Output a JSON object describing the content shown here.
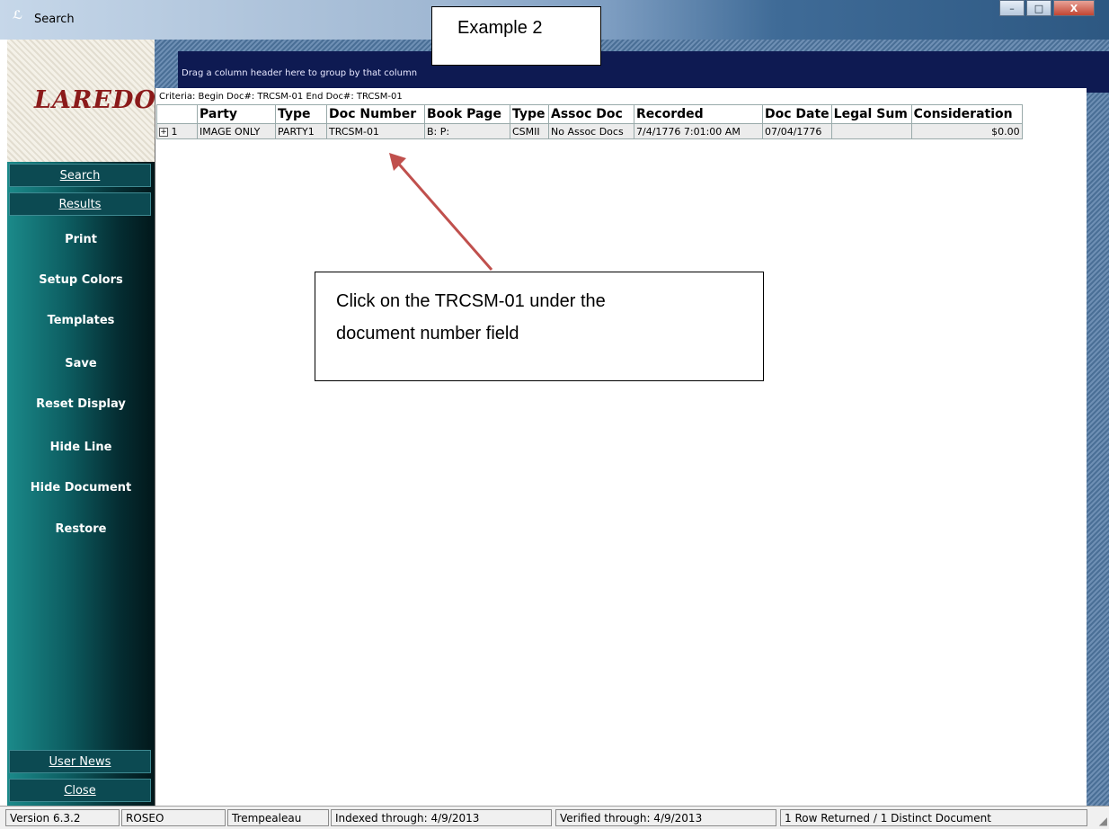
{
  "window": {
    "title": "Search",
    "app_icon": "laredo-app-icon",
    "controls": {
      "minimize": "–",
      "maximize": "□",
      "close": "X"
    }
  },
  "callouts": {
    "top": "Example 2",
    "main_line1": "Click on the TRCSM-01 under the",
    "main_line2": "document number field",
    "arrow_color": "#c0504d"
  },
  "sidebar": {
    "logo": "LAREDO",
    "tabs": {
      "search": "Search",
      "results": "Results"
    },
    "items": [
      "Print",
      "Setup Colors",
      "Templates",
      "Save",
      "Reset Display",
      "Hide Line",
      "Hide Document",
      "Restore"
    ],
    "bottom_tabs": {
      "user_news": "User News",
      "close": "Close"
    }
  },
  "main": {
    "group_hint": "Drag a column header here to group by that column",
    "criteria": "Criteria: Begin Doc#: TRCSM-01 End Doc#: TRCSM-01",
    "columns": [
      "",
      "Party",
      "Type",
      "Doc Number",
      "Book Page",
      "Type",
      "Assoc Doc",
      "Recorded",
      "Doc Date",
      "Legal Sum",
      "Consideration"
    ],
    "rows": [
      {
        "index": "1",
        "party": "IMAGE ONLY",
        "type": "PARTY1",
        "doc_number": "TRCSM-01",
        "book_page": "B:  P:",
        "doc_type": "CSMII",
        "assoc_doc": "No Assoc Docs",
        "recorded": "7/4/1776 7:01:00 AM",
        "doc_date": "07/04/1776",
        "legal_sum": "",
        "consideration": "$0.00"
      }
    ]
  },
  "status": {
    "version": "Version 6.3.2",
    "user": "ROSEO",
    "county": "Trempealeau",
    "indexed": "Indexed through: 4/9/2013",
    "verified": "Verified through: 4/9/2013",
    "returned": "1 Row Returned / 1 Distinct Document"
  }
}
